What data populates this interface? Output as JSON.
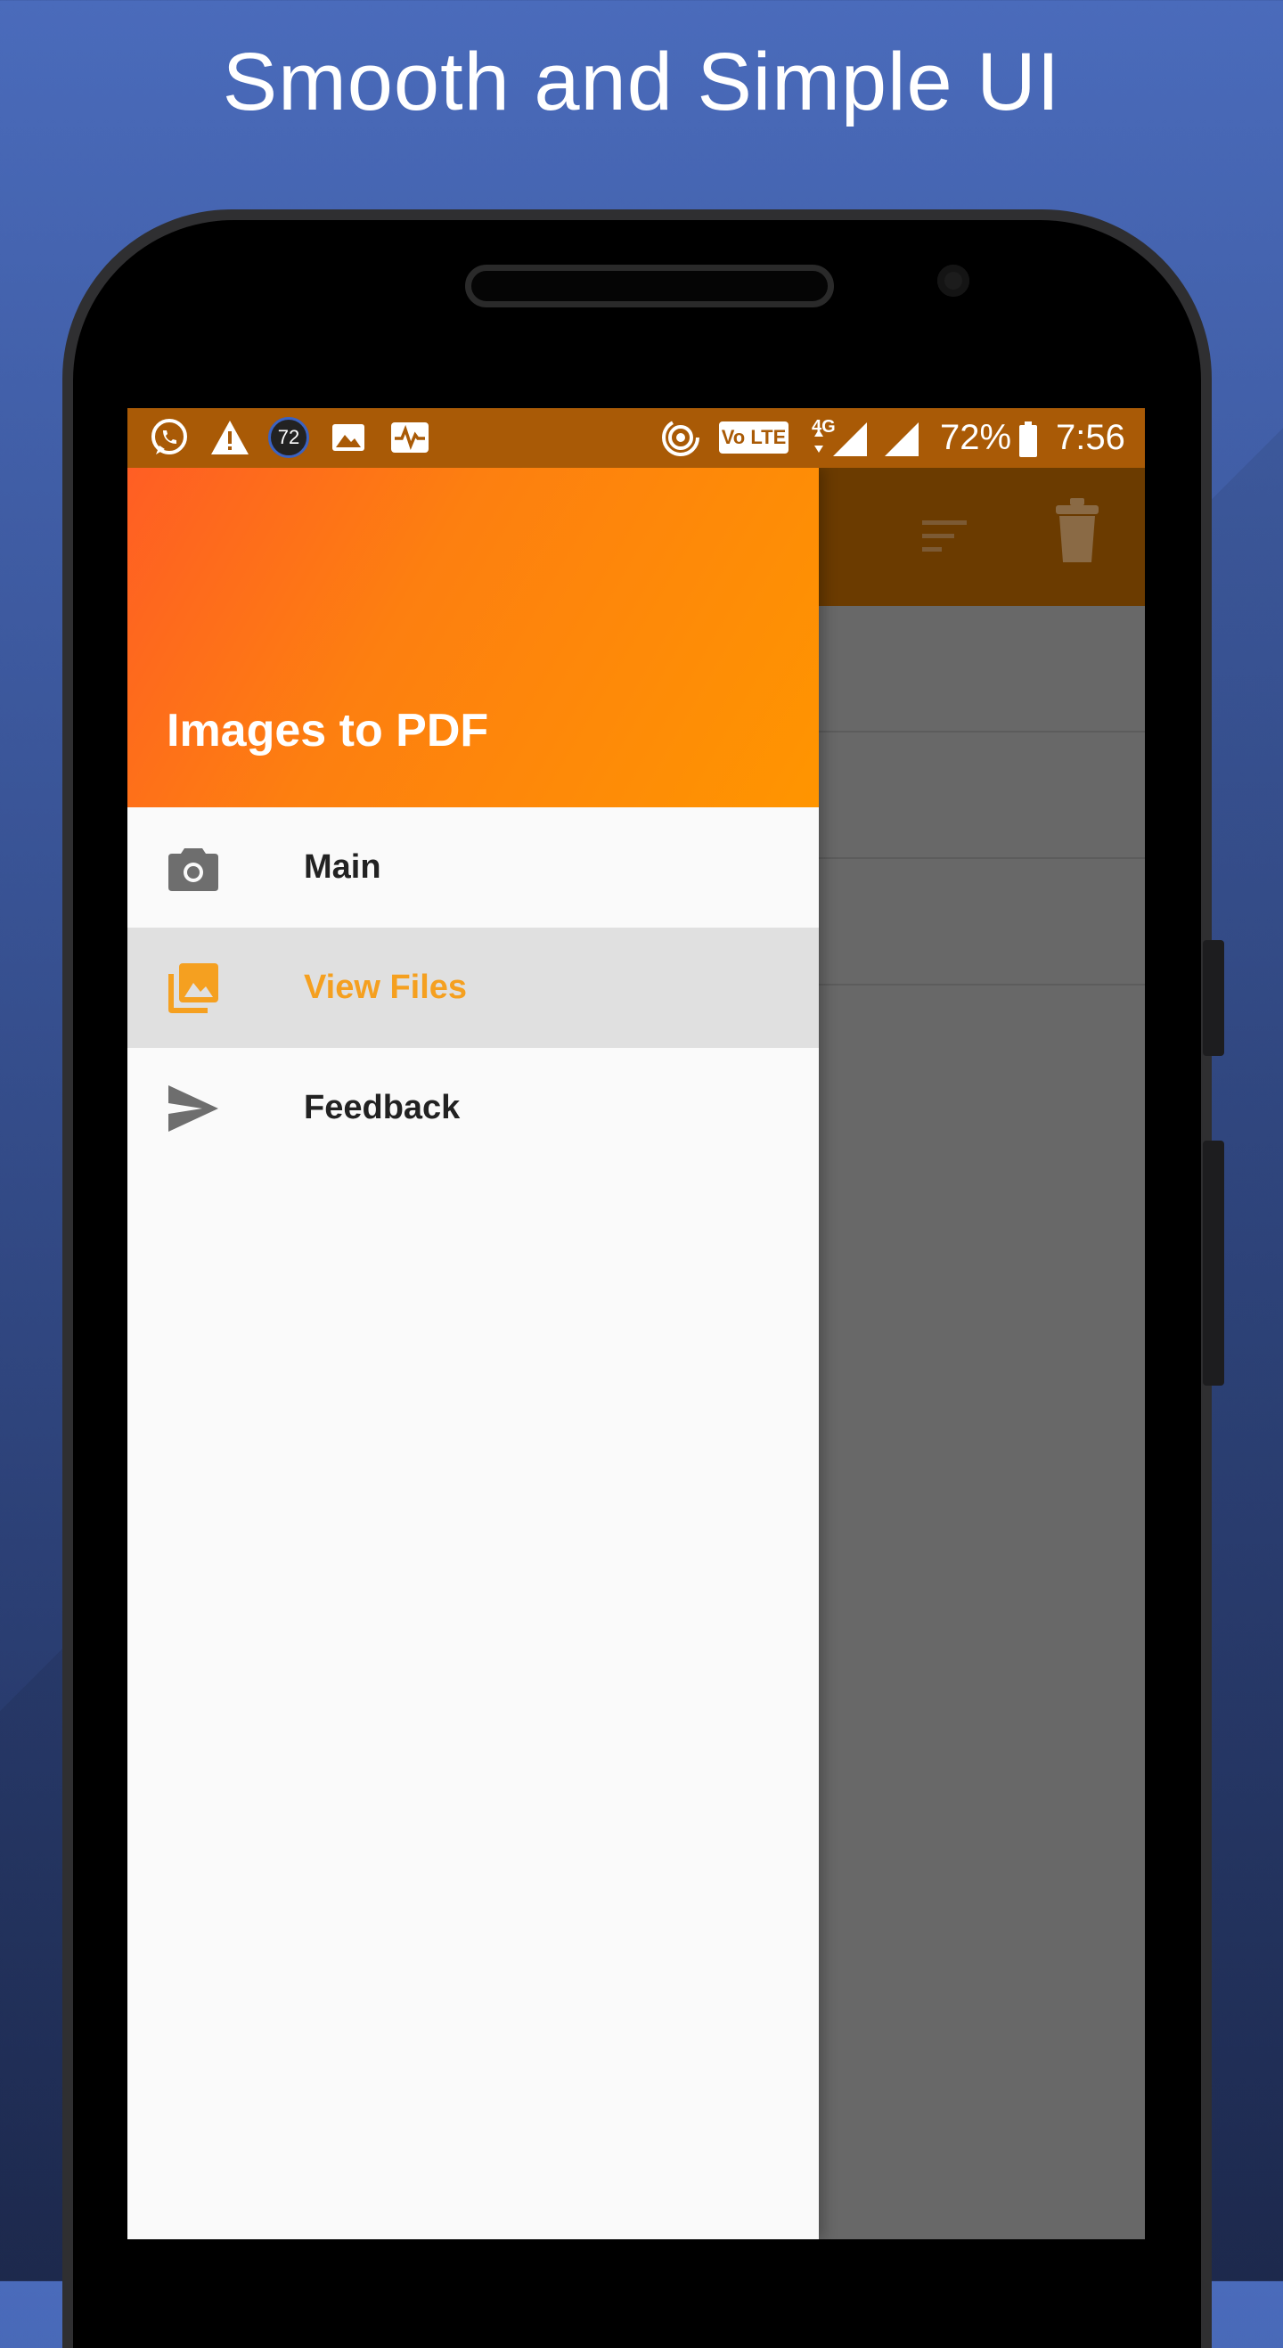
{
  "promo": {
    "title": "Smooth and Simple UI"
  },
  "status_bar": {
    "notification_icons": [
      "whatsapp-icon",
      "warning-icon",
      "counter-badge-icon",
      "image-icon",
      "activity-icon"
    ],
    "counter_badge": "72",
    "volte_label": "Vo LTE",
    "network_label": "4G",
    "battery_percent": "72%",
    "time": "7:56"
  },
  "app_toolbar": {
    "icons": [
      "sort-icon",
      "trash-icon"
    ]
  },
  "drawer": {
    "title": "Images to PDF",
    "items": [
      {
        "label": "Main",
        "icon": "camera-icon",
        "active": false
      },
      {
        "label": "View Files",
        "icon": "photo-library-icon",
        "active": true
      },
      {
        "label": "Feedback",
        "icon": "send-icon",
        "active": false
      }
    ]
  },
  "colors": {
    "accent": "#f5a020",
    "header_start": "#ff5e24",
    "header_end": "#ff9500",
    "status_bar": "#a95a06",
    "background": "#3a5598"
  }
}
